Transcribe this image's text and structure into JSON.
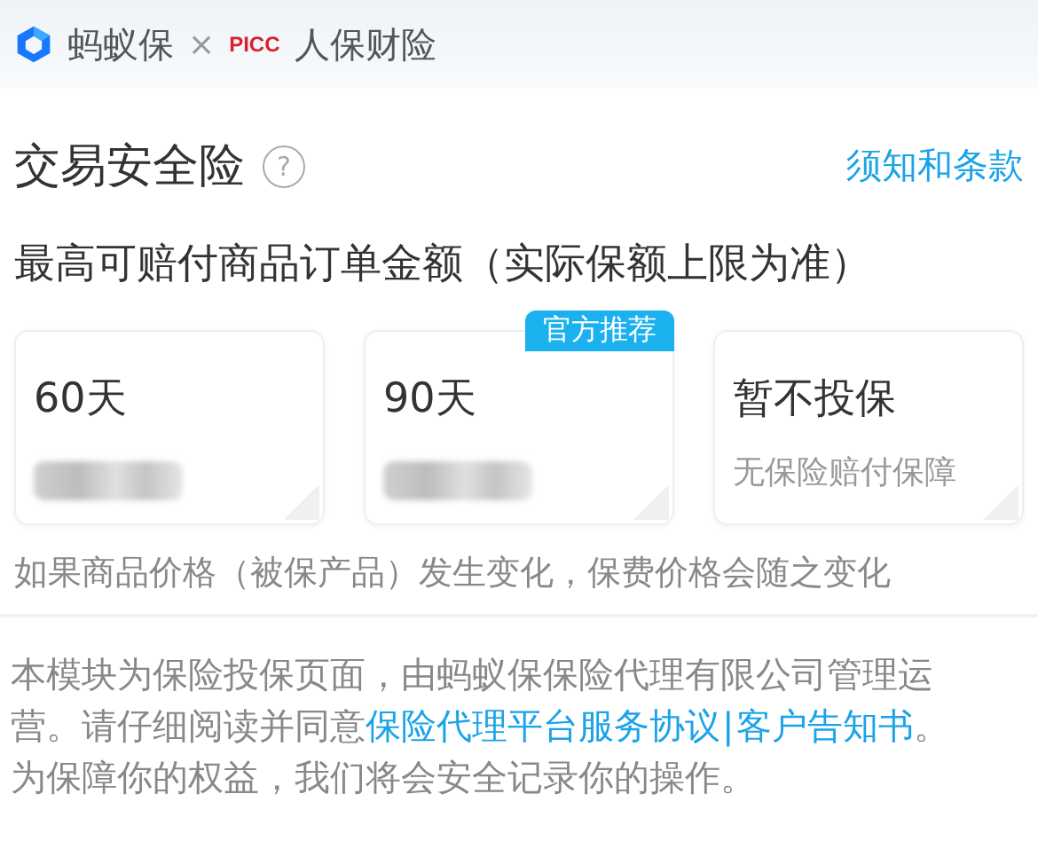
{
  "header": {
    "brand": "蚂蚁保",
    "times": "×",
    "partner_logo": "PICC",
    "partner": "人保财险"
  },
  "title": {
    "text": "交易安全险",
    "help": "?",
    "link": "须知和条款"
  },
  "subtitle": "最高可赔付商品订单金额（实际保额上限为准）",
  "options": [
    {
      "label": "60天",
      "price_hidden": true,
      "selected": false
    },
    {
      "label": "90天",
      "price_hidden": true,
      "badge": "官方推荐",
      "selected": false
    },
    {
      "label": "暂不投保",
      "note": "无保险赔付保障",
      "selected": false
    }
  ],
  "price_note": "如果商品价格（被保产品）发生变化，保费价格会随之变化",
  "notice": {
    "before": "本模块为保险投保页面，由蚂蚁保保险代理有限公司管理运营。请仔细阅读并同意",
    "links": [
      "保险代理平台服务协议",
      "客户告知书"
    ],
    "separator": "|",
    "after": "。为保障你的权益，我们将会安全记录你的操作。"
  }
}
